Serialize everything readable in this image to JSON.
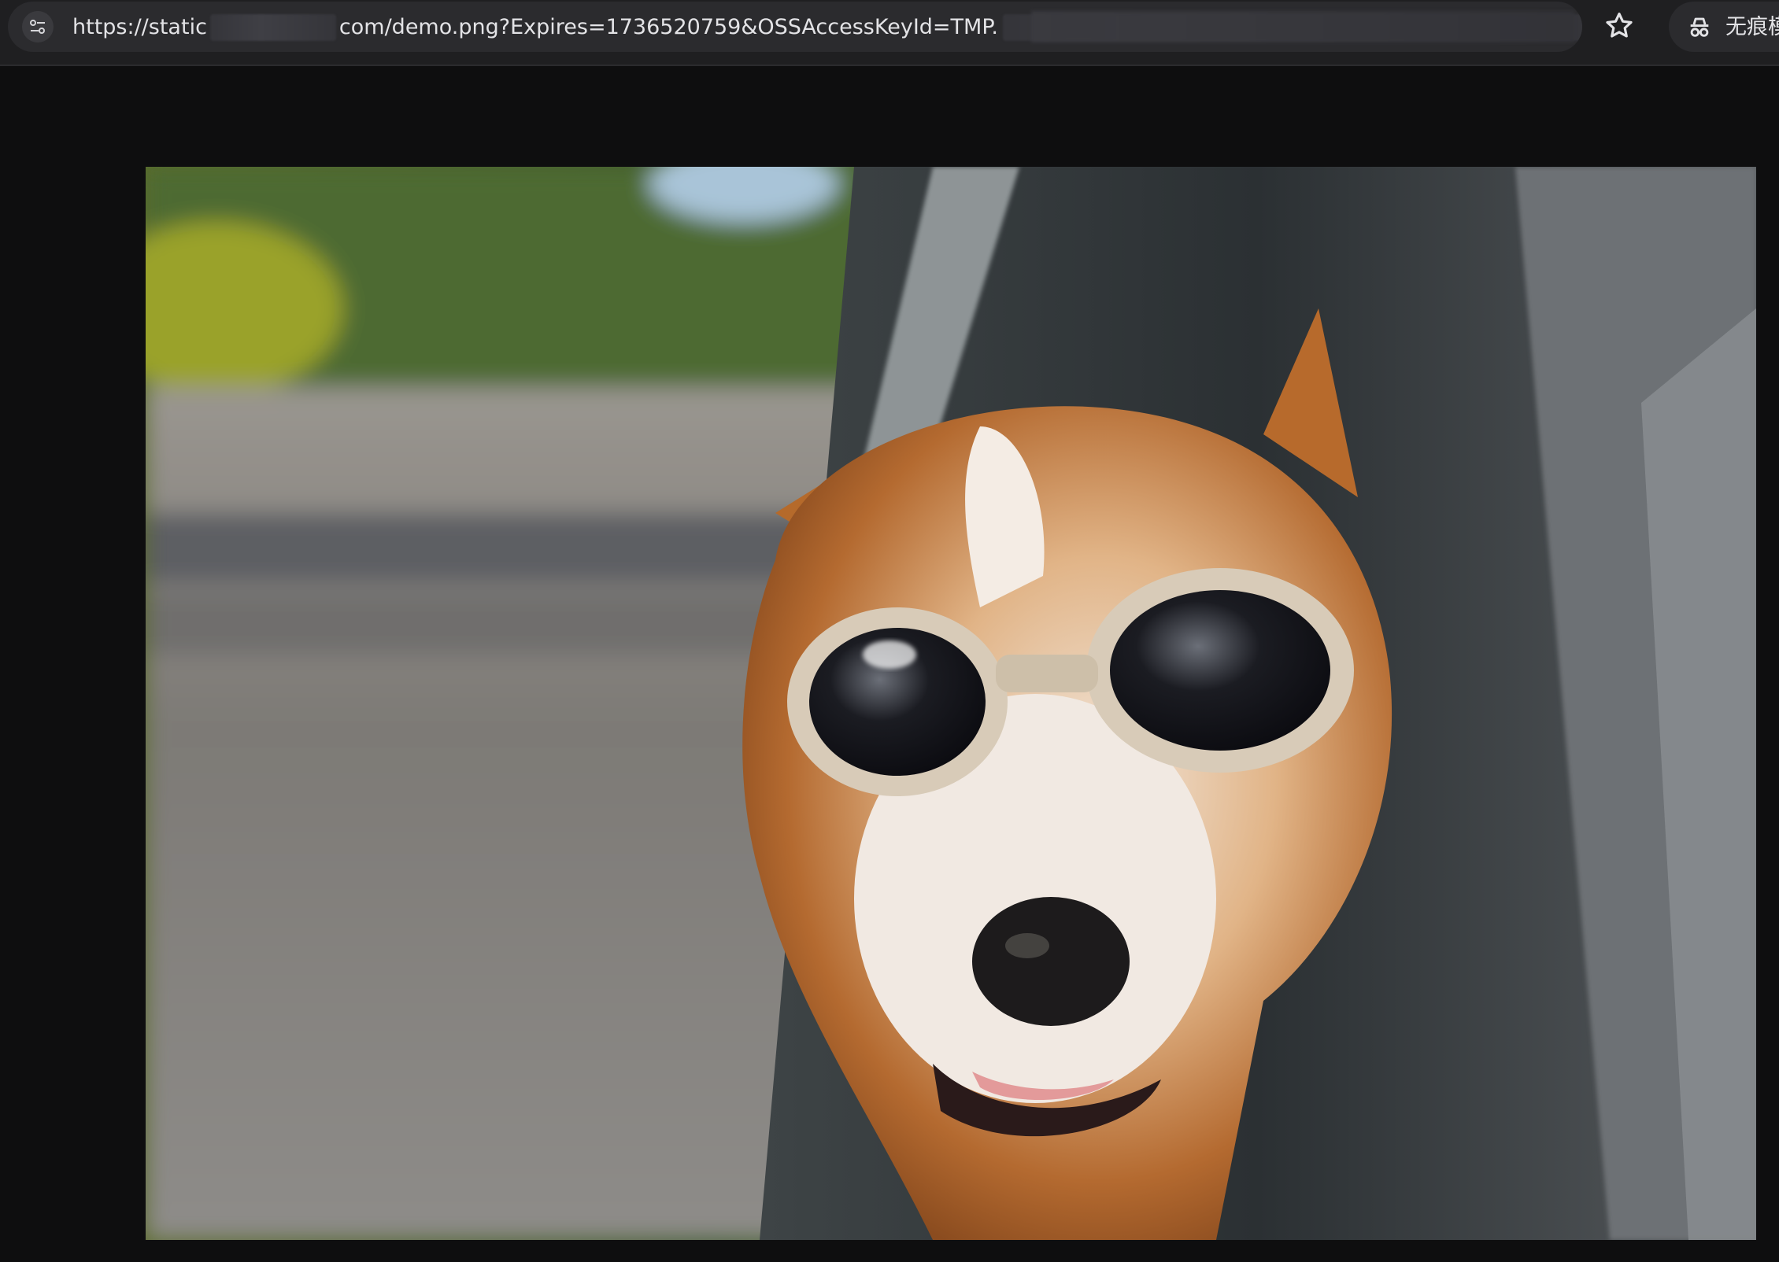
{
  "browser": {
    "url_prefix": "https://static",
    "url_main": "com/demo.png?Expires=1736520759&OSSAccessKeyId=TMP.",
    "incognito_label": "无痕模式",
    "icons": {
      "site_info": "tune-icon",
      "bookmark": "star-icon",
      "incognito": "incognito-icon"
    }
  },
  "image": {
    "subject": "photo"
  },
  "colors": {
    "toolbar_bg": "#1f1f21",
    "omnibox_bg": "#2b2b2e",
    "page_bg": "#0e0e0f",
    "text": "#e3e3e6"
  }
}
